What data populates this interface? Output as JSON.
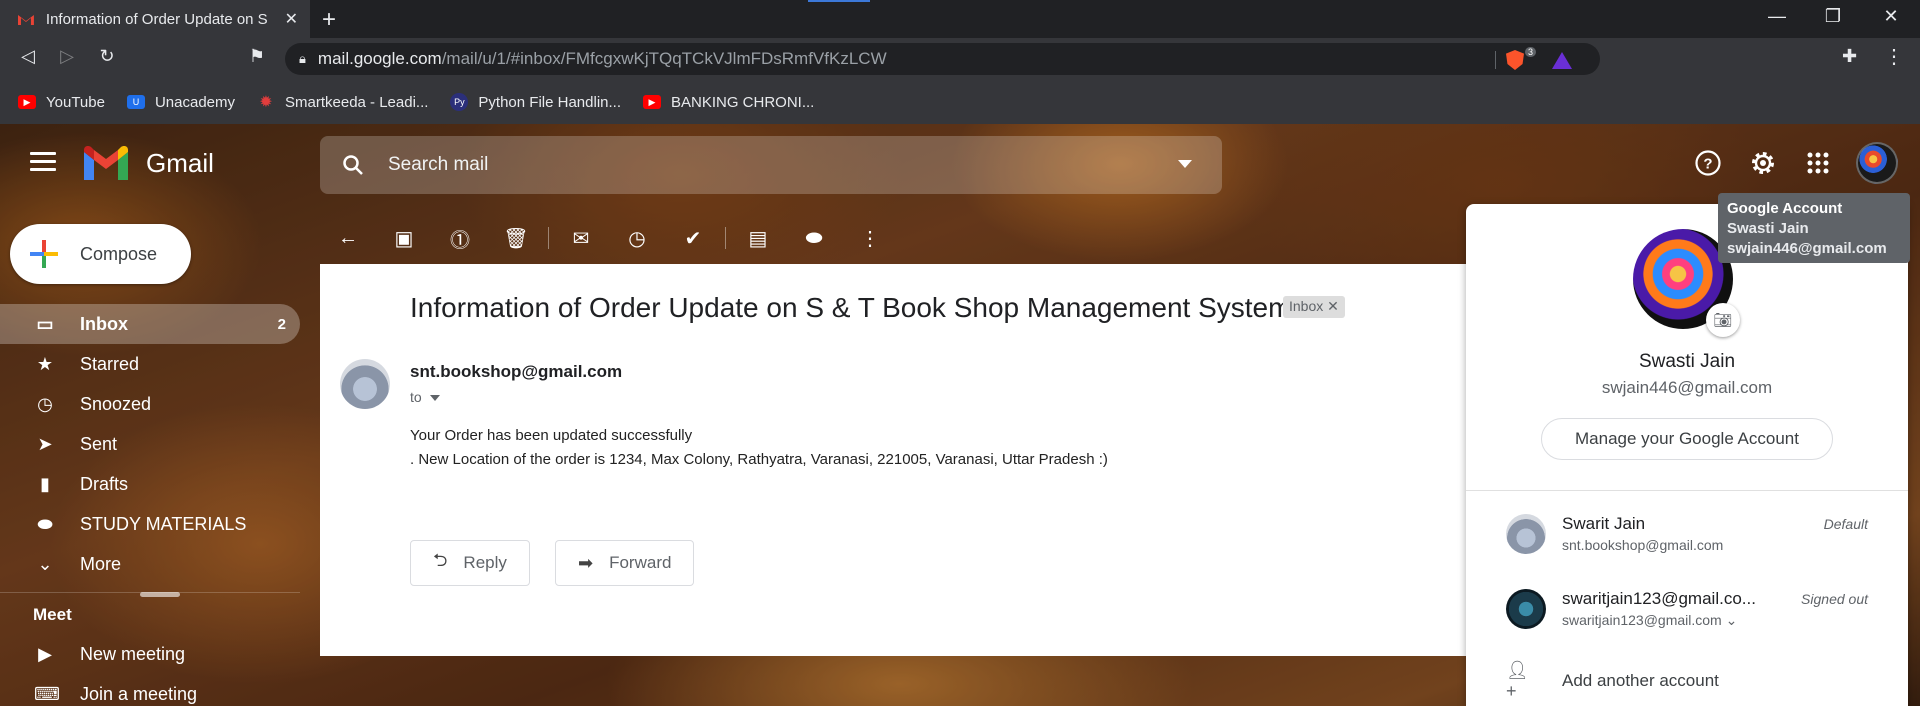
{
  "browser": {
    "tab_title": "Information of Order Update on S",
    "url_host": "mail.google.com",
    "url_path": "/mail/u/1/#inbox/FMfcgxwKjTQqTCkVJlmFDsRmfVfKzLCW",
    "brave_count": "3"
  },
  "bookmarks": [
    {
      "label": "YouTube",
      "icon": "youtube-icon"
    },
    {
      "label": "Unacademy",
      "icon": "unacademy-icon"
    },
    {
      "label": "Smartkeeda - Leadi...",
      "icon": "smartkeeda-icon"
    },
    {
      "label": "Python File Handlin...",
      "icon": "python-icon"
    },
    {
      "label": "BANKING CHRONI...",
      "icon": "youtube-icon"
    }
  ],
  "gmail": {
    "app_name": "Gmail",
    "search_placeholder": "Search mail",
    "compose_label": "Compose"
  },
  "tooltip": {
    "title": "Google Account",
    "name": "Swasti Jain",
    "email": "swjain446@gmail.com"
  },
  "sidebar": {
    "items": [
      {
        "label": "Inbox",
        "count": "2",
        "icon": "inbox-icon"
      },
      {
        "label": "Starred",
        "count": "",
        "icon": "star-icon"
      },
      {
        "label": "Snoozed",
        "count": "",
        "icon": "clock-icon"
      },
      {
        "label": "Sent",
        "count": "",
        "icon": "send-icon"
      },
      {
        "label": "Drafts",
        "count": "",
        "icon": "draft-icon"
      },
      {
        "label": "STUDY MATERIALS",
        "count": "",
        "icon": "label-icon"
      },
      {
        "label": "More",
        "count": "",
        "icon": "chevron-down-icon"
      }
    ],
    "meet_title": "Meet",
    "meet_items": [
      {
        "label": "New meeting",
        "icon": "video-icon"
      },
      {
        "label": "Join a meeting",
        "icon": "keyboard-icon"
      }
    ]
  },
  "email": {
    "subject": "Information of Order Update on S & T Book Shop Management System",
    "label_chip": "Inbox",
    "sender": "snt.bookshop@gmail.com",
    "to_label": "to",
    "body_line1": "Your Order has been updated successfully",
    "body_line2": ". New Location of the order is 1234, Max Colony, Rathyatra, Varanasi, 221005, Varanasi, Uttar Pradesh :)",
    "reply_label": "Reply",
    "forward_label": "Forward"
  },
  "account_popup": {
    "name": "Swasti Jain",
    "email": "swjain446@gmail.com",
    "manage_label": "Manage your Google Account",
    "other_accounts": [
      {
        "name": "Swarit Jain",
        "email": "snt.bookshop@gmail.com",
        "status": "Default"
      },
      {
        "name": "swaritjain123@gmail.co...",
        "email": "swaritjain123@gmail.com",
        "status": "Signed out"
      }
    ],
    "add_account_label": "Add another account"
  }
}
